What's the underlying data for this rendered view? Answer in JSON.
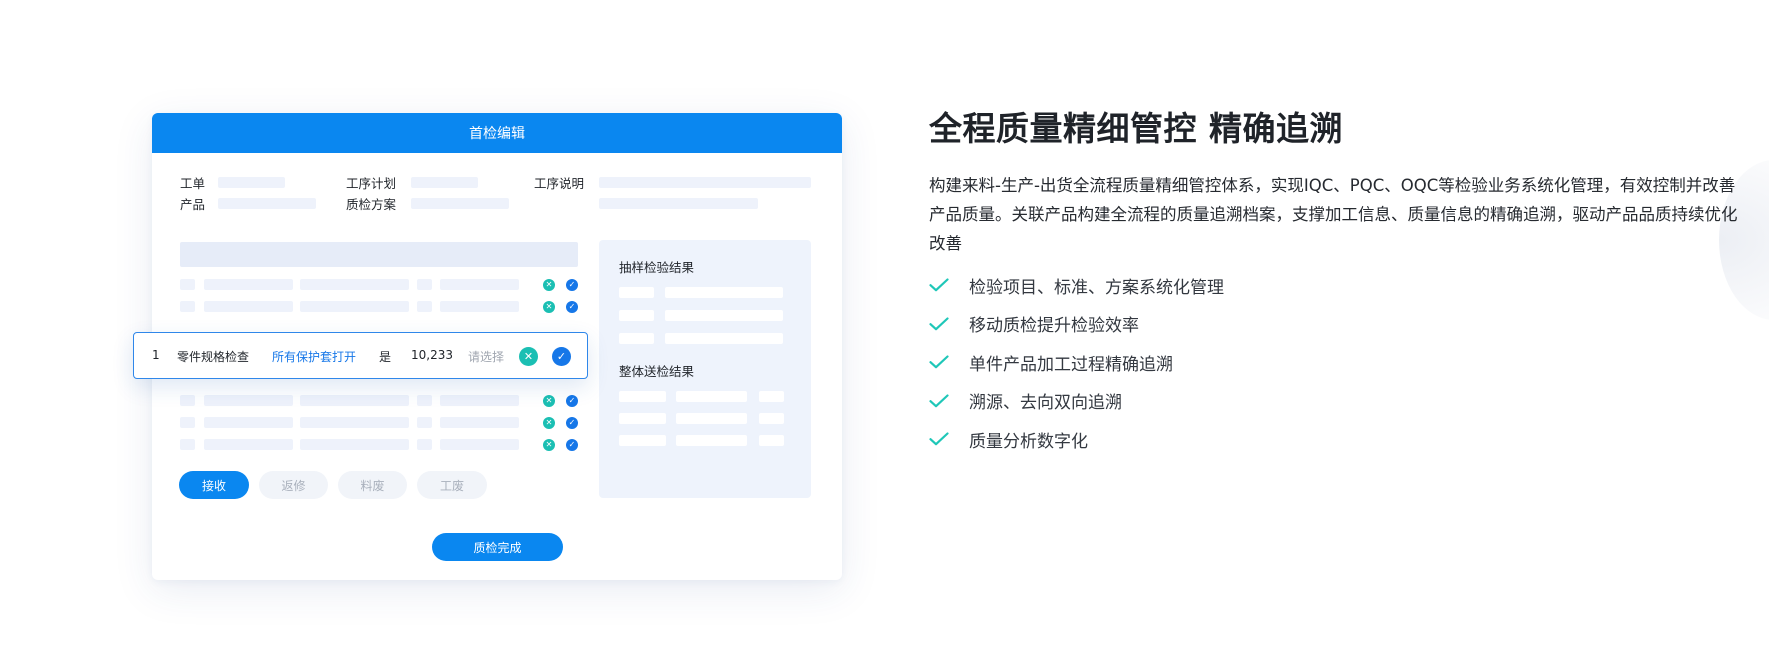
{
  "mockup": {
    "header_title": "首检编辑",
    "fields": {
      "work_order": "工单",
      "process_plan": "工序计划",
      "process_desc": "工序说明",
      "product": "产品",
      "qc_scheme": "质检方案"
    },
    "active_row": {
      "index": "1",
      "item": "零件规格检查",
      "standard": "所有保护套打开",
      "result": "是",
      "value": "10,233",
      "select_placeholder": "请选择"
    },
    "panel": {
      "sampling_title": "抽样检验结果",
      "overall_title": "整体送检结果"
    },
    "actions": {
      "accept": "接收",
      "rework": "返修",
      "material_scrap": "料废",
      "process_scrap": "工废"
    },
    "finish_button": "质检完成"
  },
  "content": {
    "title": "全程质量精细管控 精确追溯",
    "description": "构建来料-生产-出货全流程质量精细管控体系，实现IQC、PQC、OQC等检验业务系统化管理，有效控制并改善产品质量。关联产品构建全流程的质量追溯档案，支撑加工信息、质量信息的精确追溯，驱动产品品质持续优化改善",
    "features": [
      "检验项目、标准、方案系统化管理",
      "移动质检提升检验效率",
      "单件产品加工过程精确追溯",
      "溯源、去向双向追溯",
      "质量分析数字化"
    ]
  },
  "colors": {
    "primary": "#0a87f0",
    "teal": "#1bbfb3",
    "check": "#1fc7b8",
    "placeholder": "#eef2fb"
  }
}
